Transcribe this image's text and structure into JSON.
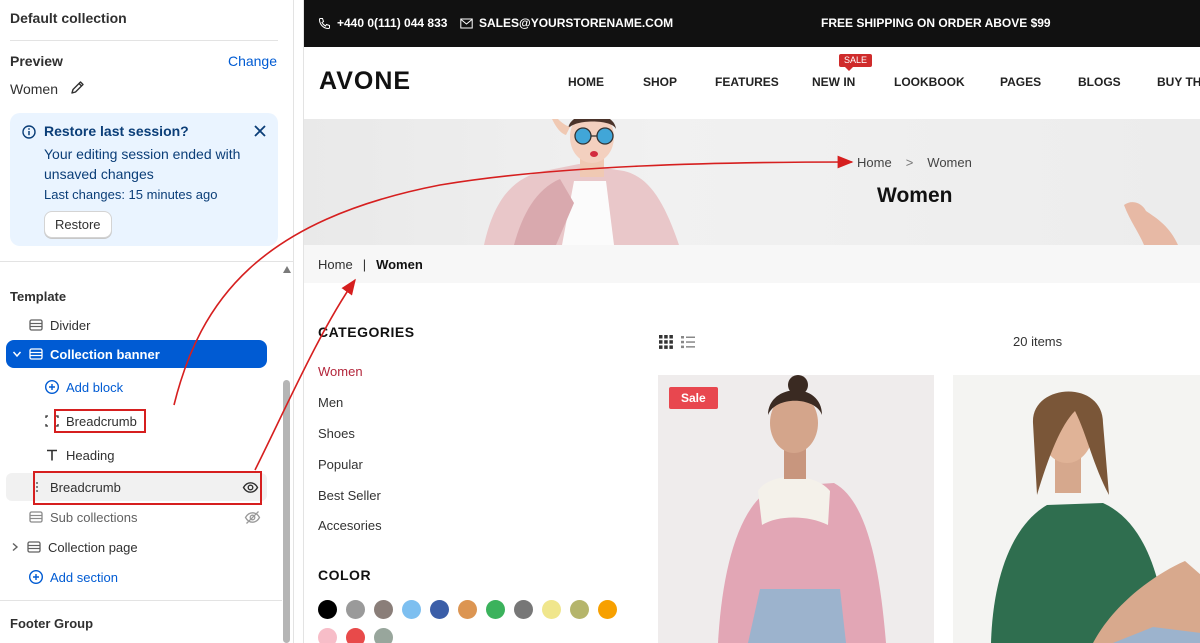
{
  "sidebar": {
    "title": "Default collection",
    "preview": {
      "label": "Preview",
      "change": "Change",
      "value": "Women"
    },
    "restore_banner": {
      "title": "Restore last session?",
      "text": "Your editing session ended with unsaved changes",
      "last_changes": "Last changes: 15 minutes ago",
      "button": "Restore"
    },
    "template_label": "Template",
    "tree": {
      "divider": "Divider",
      "collection_banner": "Collection banner",
      "add_block": "Add block",
      "breadcrumb_block": "Breadcrumb",
      "heading_block": "Heading",
      "breadcrumb_section": "Breadcrumb",
      "sub_collections": "Sub collections",
      "collection_page": "Collection page",
      "add_section": "Add section"
    },
    "footer_group": "Footer Group"
  },
  "store": {
    "topbar": {
      "phone": "+440 0(111) 044 833",
      "email": "SALES@YOURSTORENAME.COM",
      "shipping": "FREE SHIPPING ON ORDER ABOVE $99"
    },
    "logo": "AVONE",
    "menu": [
      "HOME",
      "SHOP",
      "FEATURES",
      "NEW IN",
      "LOOKBOOK",
      "PAGES",
      "BLOGS",
      "BUY THI"
    ],
    "sale_tag": "SALE",
    "hero": {
      "crumb_home": "Home",
      "crumb_sep": ">",
      "crumb_current": "Women",
      "title": "Women"
    },
    "crumb_bar": {
      "home": "Home",
      "sep": "|",
      "current": "Women"
    },
    "categories": {
      "title": "CATEGORIES",
      "items": [
        "Women",
        "Men",
        "Shoes",
        "Popular",
        "Best Seller",
        "Accesories"
      ]
    },
    "color": {
      "title": "COLOR",
      "swatches": [
        "#000000",
        "#9a9a9a",
        "#8a7e79",
        "#7dbff0",
        "#3b5ea8",
        "#dc9552",
        "#3bb25c",
        "#777777",
        "#f0e68c",
        "#b5b56b",
        "#f7a000",
        "#f7bdc8",
        "#e84a4a",
        "#98a69c"
      ]
    },
    "items_count": "20 items",
    "sale_badge": "Sale"
  },
  "colors": {
    "accent": "#005bd3",
    "annotation": "#d61f1f",
    "active_category": "#b3263b"
  }
}
